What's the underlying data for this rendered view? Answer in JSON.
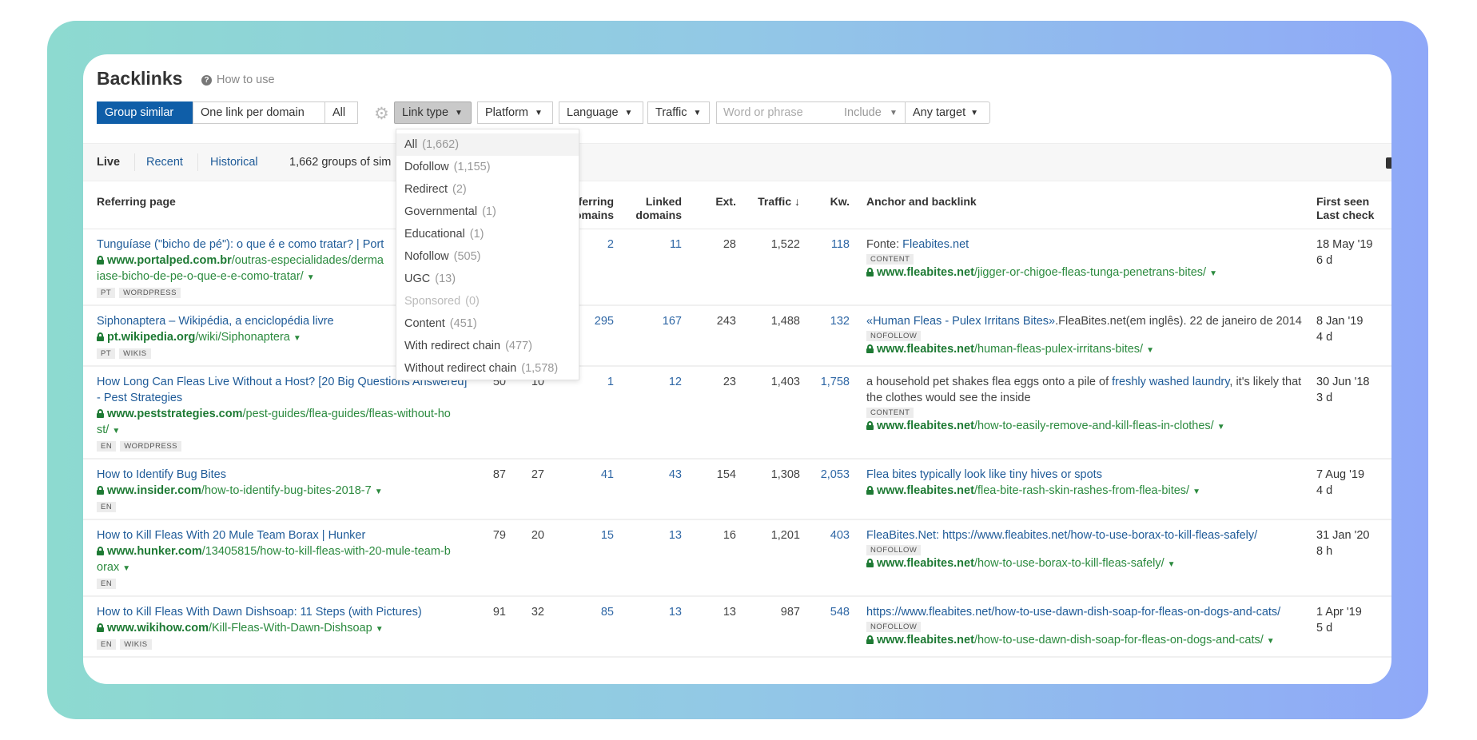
{
  "header": {
    "title": "Backlinks",
    "how_to_use": "How to use"
  },
  "toolbar": {
    "mode_buttons": [
      "Group similar",
      "One link per domain",
      "All"
    ],
    "filters": [
      "Link type",
      "Platform",
      "Language",
      "Traffic"
    ],
    "search_placeholder": "Word or phrase",
    "include": "Include",
    "target": "Any target"
  },
  "tabs": {
    "live": "Live",
    "recent": "Recent",
    "historical": "Historical",
    "summary": "1,662 groups of sim"
  },
  "link_type_menu": [
    {
      "label": "All",
      "count": "(1,662)",
      "selected": true
    },
    {
      "label": "Dofollow",
      "count": "(1,155)"
    },
    {
      "label": "Redirect",
      "count": "(2)"
    },
    {
      "label": "Governmental",
      "count": "(1)"
    },
    {
      "label": "Educational",
      "count": "(1)"
    },
    {
      "label": "Nofollow",
      "count": "(505)"
    },
    {
      "label": "UGC",
      "count": "(13)"
    },
    {
      "label": "Sponsored",
      "count": "(0)",
      "disabled": true
    },
    {
      "label": "Content",
      "count": "(451)"
    },
    {
      "label": "With redirect chain",
      "count": "(477)"
    },
    {
      "label": "Without redirect chain",
      "count": "(1,578)"
    }
  ],
  "columns": {
    "referring_page": "Referring page",
    "referring_domains": "Referring domains",
    "linked_domains_1": "Linked",
    "linked_domains_2": "domains",
    "ext": "Ext.",
    "traffic": "Traffic ↓",
    "kw": "Kw.",
    "anchor": "Anchor and backlink",
    "first_seen": "First seen",
    "last_check": "Last check"
  },
  "rows": [
    {
      "title": "Tunguíase (\"bicho de pé\"): o que é e como tratar? | Port",
      "domain": "www.portalped.com.br",
      "path": "/outras-especialidades/derma",
      "path_cont": "iase-bicho-de-pe-o-que-e-e-como-tratar/",
      "tags": [
        "PT",
        "WORDPRESS"
      ],
      "dr": "",
      "ur": "",
      "ref_domains": "2",
      "linked_domains": "11",
      "ext": "28",
      "traffic": "1,522",
      "kw": "118",
      "anchor": [
        {
          "text": "Fonte: ",
          "link": false
        },
        {
          "text": "Fleabites.net",
          "link": true
        }
      ],
      "anchor_tag": "CONTENT",
      "bl_domain": "www.fleabites.net",
      "bl_path": "/jigger-or-chigoe-fleas-tunga-penetrans-bites/",
      "first_seen": "18 May '19",
      "last_check": "6 d"
    },
    {
      "title": "Siphonaptera – Wikipédia, a enciclopédia livre",
      "domain": "pt.wikipedia.org",
      "path": "/wiki/Siphonaptera",
      "path_cont": "",
      "tags": [
        "PT",
        "WIKIS"
      ],
      "dr": "",
      "ur": "",
      "ref_domains": "295",
      "linked_domains": "167",
      "ext": "243",
      "traffic": "1,488",
      "kw": "132",
      "anchor": [
        {
          "text": "«Human Fleas - Pulex Irritans Bites»",
          "link": true
        },
        {
          "text": ".FleaBites.net(em inglês). 22 de janeiro de 2014",
          "link": false
        }
      ],
      "anchor_tag": "NOFOLLOW",
      "bl_domain": "www.fleabites.net",
      "bl_path": "/human-fleas-pulex-irritans-bites/",
      "first_seen": "8 Jan '19",
      "last_check": "4 d"
    },
    {
      "title": "How Long Can Fleas Live Without a Host? [20 Big Questions Answered] - Pest Strategies",
      "domain": "www.peststrategies.com",
      "path": "/pest-guides/flea-guides/fleas-without-ho",
      "path_cont": "st/",
      "tags": [
        "EN",
        "WORDPRESS"
      ],
      "dr": "50",
      "ur": "10",
      "ref_domains": "1",
      "linked_domains": "12",
      "ext": "23",
      "traffic": "1,403",
      "kw": "1,758",
      "anchor": [
        {
          "text": "a household pet shakes flea eggs onto a pile of ",
          "link": false
        },
        {
          "text": "freshly washed laundry",
          "link": true
        },
        {
          "text": ", it's likely that the clothes would see the inside",
          "link": false
        }
      ],
      "anchor_tag": "CONTENT",
      "bl_domain": "www.fleabites.net",
      "bl_path": "/how-to-easily-remove-and-kill-fleas-in-clothes/",
      "first_seen": "30 Jun '18",
      "last_check": "3 d"
    },
    {
      "title": "How to Identify Bug Bites",
      "domain": "www.insider.com",
      "path": "/how-to-identify-bug-bites-2018-7",
      "path_cont": "",
      "tags": [
        "EN"
      ],
      "dr": "87",
      "ur": "27",
      "ref_domains": "41",
      "linked_domains": "43",
      "ext": "154",
      "traffic": "1,308",
      "kw": "2,053",
      "anchor": [
        {
          "text": "Flea bites typically look like tiny hives or spots",
          "link": true
        }
      ],
      "anchor_tag": "",
      "bl_domain": "www.fleabites.net",
      "bl_path": "/flea-bite-rash-skin-rashes-from-flea-bites/",
      "first_seen": "7 Aug '19",
      "last_check": "4 d"
    },
    {
      "title": "How to Kill Fleas With 20 Mule Team Borax | Hunker",
      "domain": "www.hunker.com",
      "path": "/13405815/how-to-kill-fleas-with-20-mule-team-b",
      "path_cont": "orax",
      "tags": [
        "EN"
      ],
      "dr": "79",
      "ur": "20",
      "ref_domains": "15",
      "linked_domains": "13",
      "ext": "16",
      "traffic": "1,201",
      "kw": "403",
      "anchor": [
        {
          "text": "FleaBites.Net: https://www.fleabites.net/how-to-use-borax-to-kill-fleas-safely/",
          "link": true
        }
      ],
      "anchor_tag": "NOFOLLOW",
      "bl_domain": "www.fleabites.net",
      "bl_path": "/how-to-use-borax-to-kill-fleas-safely/",
      "first_seen": "31 Jan '20",
      "last_check": "8 h"
    },
    {
      "title": "How to Kill Fleas With Dawn Dishsoap: 11 Steps (with Pictures)",
      "domain": "www.wikihow.com",
      "path": "/Kill-Fleas-With-Dawn-Dishsoap",
      "path_cont": "",
      "tags": [
        "EN",
        "WIKIS"
      ],
      "dr": "91",
      "ur": "32",
      "ref_domains": "85",
      "linked_domains": "13",
      "ext": "13",
      "traffic": "987",
      "kw": "548",
      "anchor": [
        {
          "text": "https://www.fleabites.net/how-to-use-dawn-dish-soap-for-fleas-on-dogs-and-cats/",
          "link": true
        }
      ],
      "anchor_tag": "NOFOLLOW",
      "bl_domain": "www.fleabites.net",
      "bl_path": "/how-to-use-dawn-dish-soap-for-fleas-on-dogs-and-cats/",
      "first_seen": "1 Apr '19",
      "last_check": "5 d"
    }
  ],
  "colors": {
    "accent": "#0f5ea8",
    "link": "#1f5b98",
    "url_green": "#2b8a3e",
    "bg_gradient_left": "#8ddad0",
    "bg_gradient_right": "#8fa8f8"
  }
}
